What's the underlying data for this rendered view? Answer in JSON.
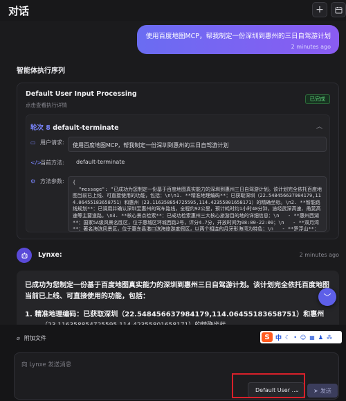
{
  "header": {
    "title": "对话",
    "new_chat_icon": "plus-icon",
    "history_icon": "calendar-icon"
  },
  "user_message": {
    "text": "使用百度地图MCP，帮我制定一份深圳到惠州的三日自驾游计划",
    "time": "2 minutes ago"
  },
  "execution": {
    "section_title": "智能体执行序列",
    "step_title": "Default User Input Processing",
    "step_subtitle": "点击查看执行详情",
    "status": "已完成",
    "round_label": "轮次 8",
    "round_name": "default-terminate",
    "user_request_label": "用户请求:",
    "user_request_value": "使用百度地图MCP，帮我制定一份深圳到惠州的三日自驾游计划",
    "method_label": "当前方法:",
    "method_value": "default-terminate",
    "params_label": "方法参数:",
    "params_text": "{\n  \"message\": \"已成功为您制定一份基于百度地图真实能力的深圳到惠州三日自驾游计划。该计划完全依托百度地图当前已上线、可直接使用的功能，包括：\\n\\n1. **精准地理编码**：已获取深圳（22.548456637984179,114.06455183658751）和惠州（23.116358854725595,114.42355801658171）的精确坐标。\\n2. **智能路线规划**：已调用并确认深圳至惠州的驾车路线，全程约92公里，预计耗时约1小时40分钟，途经武深高速、甬莞高速等主要道路。\\n3. **核心景点检索**：已成功检索惠州三大核心旅游目的地的详细信息：\\n   - **惠州西湖**：国家5A级风景名胜区，位于惠城区环城西路2号，评分4.7分，开放时间为08:00-22:00；\\n   - **双月湾**：著名海滨风景区，位于惠东县港口滨海旅游度假区，以两个相连的月牙形海湾为特色；\\n   - **罗浮山**：道教名山，岭南第一山。\""
  },
  "assistant": {
    "name": "Lynxe:",
    "time": "2 minutes ago",
    "avatar_icon": "bot-icon"
  },
  "reply": {
    "intro": "已成功为您制定一份基于百度地图真实能力的深圳到惠州三日自驾游计划。该计划完全依托百度地图当前已上线、可直接使用的功能，包括：",
    "item1": "1. 精准地理编码：已获取深圳（22.548456637984179,114.06455183658751）和惠州",
    "item1_cont": "（23.116358854725595,114.42355801658171）的精确坐标。"
  },
  "composer": {
    "attach_label": "附加文件",
    "placeholder": "向 Lynxe 发送消息",
    "agent_select": "Default User ...",
    "send_label": "发送"
  },
  "ime": {
    "chinese": "中"
  }
}
